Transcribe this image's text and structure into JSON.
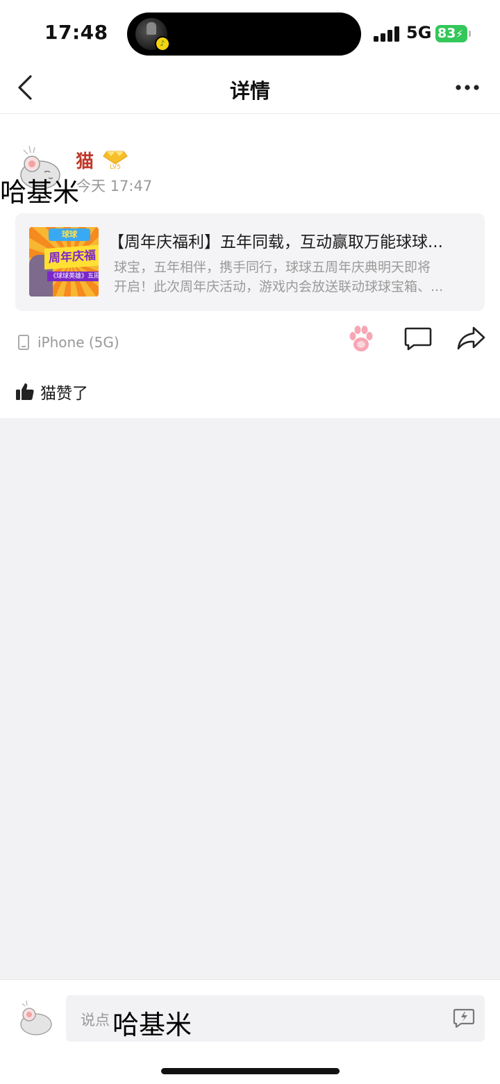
{
  "status_bar": {
    "time": "17:48",
    "island_badge": "♪",
    "network": "5G",
    "battery": "83"
  },
  "nav": {
    "title": "详情",
    "back_icon": "chevron-left-icon",
    "more_icon": "more-dots-icon"
  },
  "post": {
    "username": "猫",
    "level": "LV5",
    "time": "今天 17:47",
    "overlay_text": "哈基米",
    "card": {
      "title": "【周年庆福利】五年同载，互动赢取万能球球...",
      "desc_line1": "球宝，五年相伴，携手同行，球球五周年庆典明天即将",
      "desc_line2": "开启！此次周年庆活动，游戏内会放送联动球球宝箱、...",
      "thumb_logo": "球球",
      "thumb_title": "周年庆福",
      "thumb_sub": "《球球英雄》五周年"
    },
    "device": "iPhone (5G)",
    "liked_text": "猫赞了"
  },
  "comment_bar": {
    "placeholder": "说点",
    "overlay_text": "哈基米"
  },
  "colors": {
    "username": "#c0392b",
    "battery": "#34c759",
    "background": "#f2f2f5"
  }
}
